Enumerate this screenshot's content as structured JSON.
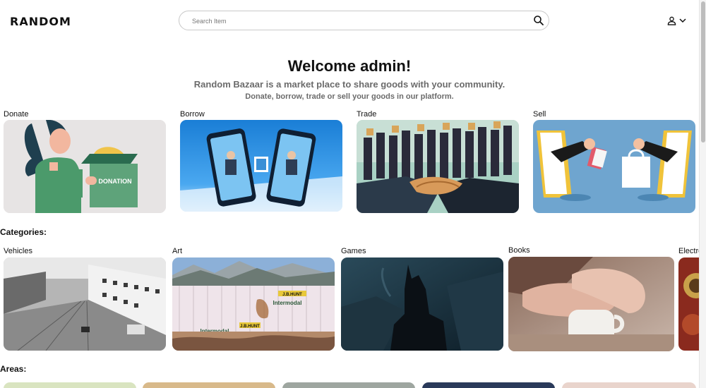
{
  "header": {
    "logo": "RANDOM",
    "search_placeholder": "Search Item"
  },
  "hero": {
    "title": "Welcome admin!",
    "subtitle": "Random Bazaar is a market place to share goods with your community.",
    "subtitle2": "Donate, borrow, trade or sell your goods in our platform."
  },
  "actions": [
    {
      "label": "Donate",
      "image_text": "DONATION"
    },
    {
      "label": "Borrow"
    },
    {
      "label": "Trade"
    },
    {
      "label": "Sell"
    }
  ],
  "categories": {
    "title": "Categories:",
    "items": [
      {
        "label": "Vehicles"
      },
      {
        "label": "Art",
        "image_text_1": "J.B.HUNT",
        "image_text_2": "Intermodal",
        "image_text_3": "J.B.HUNT",
        "image_text_4": "Intermodal"
      },
      {
        "label": "Games"
      },
      {
        "label": "Books"
      },
      {
        "label": "Electro"
      }
    ]
  },
  "areas": {
    "title": "Areas:"
  },
  "icons": [
    "search-icon",
    "user-icon",
    "chevron-down-icon"
  ]
}
